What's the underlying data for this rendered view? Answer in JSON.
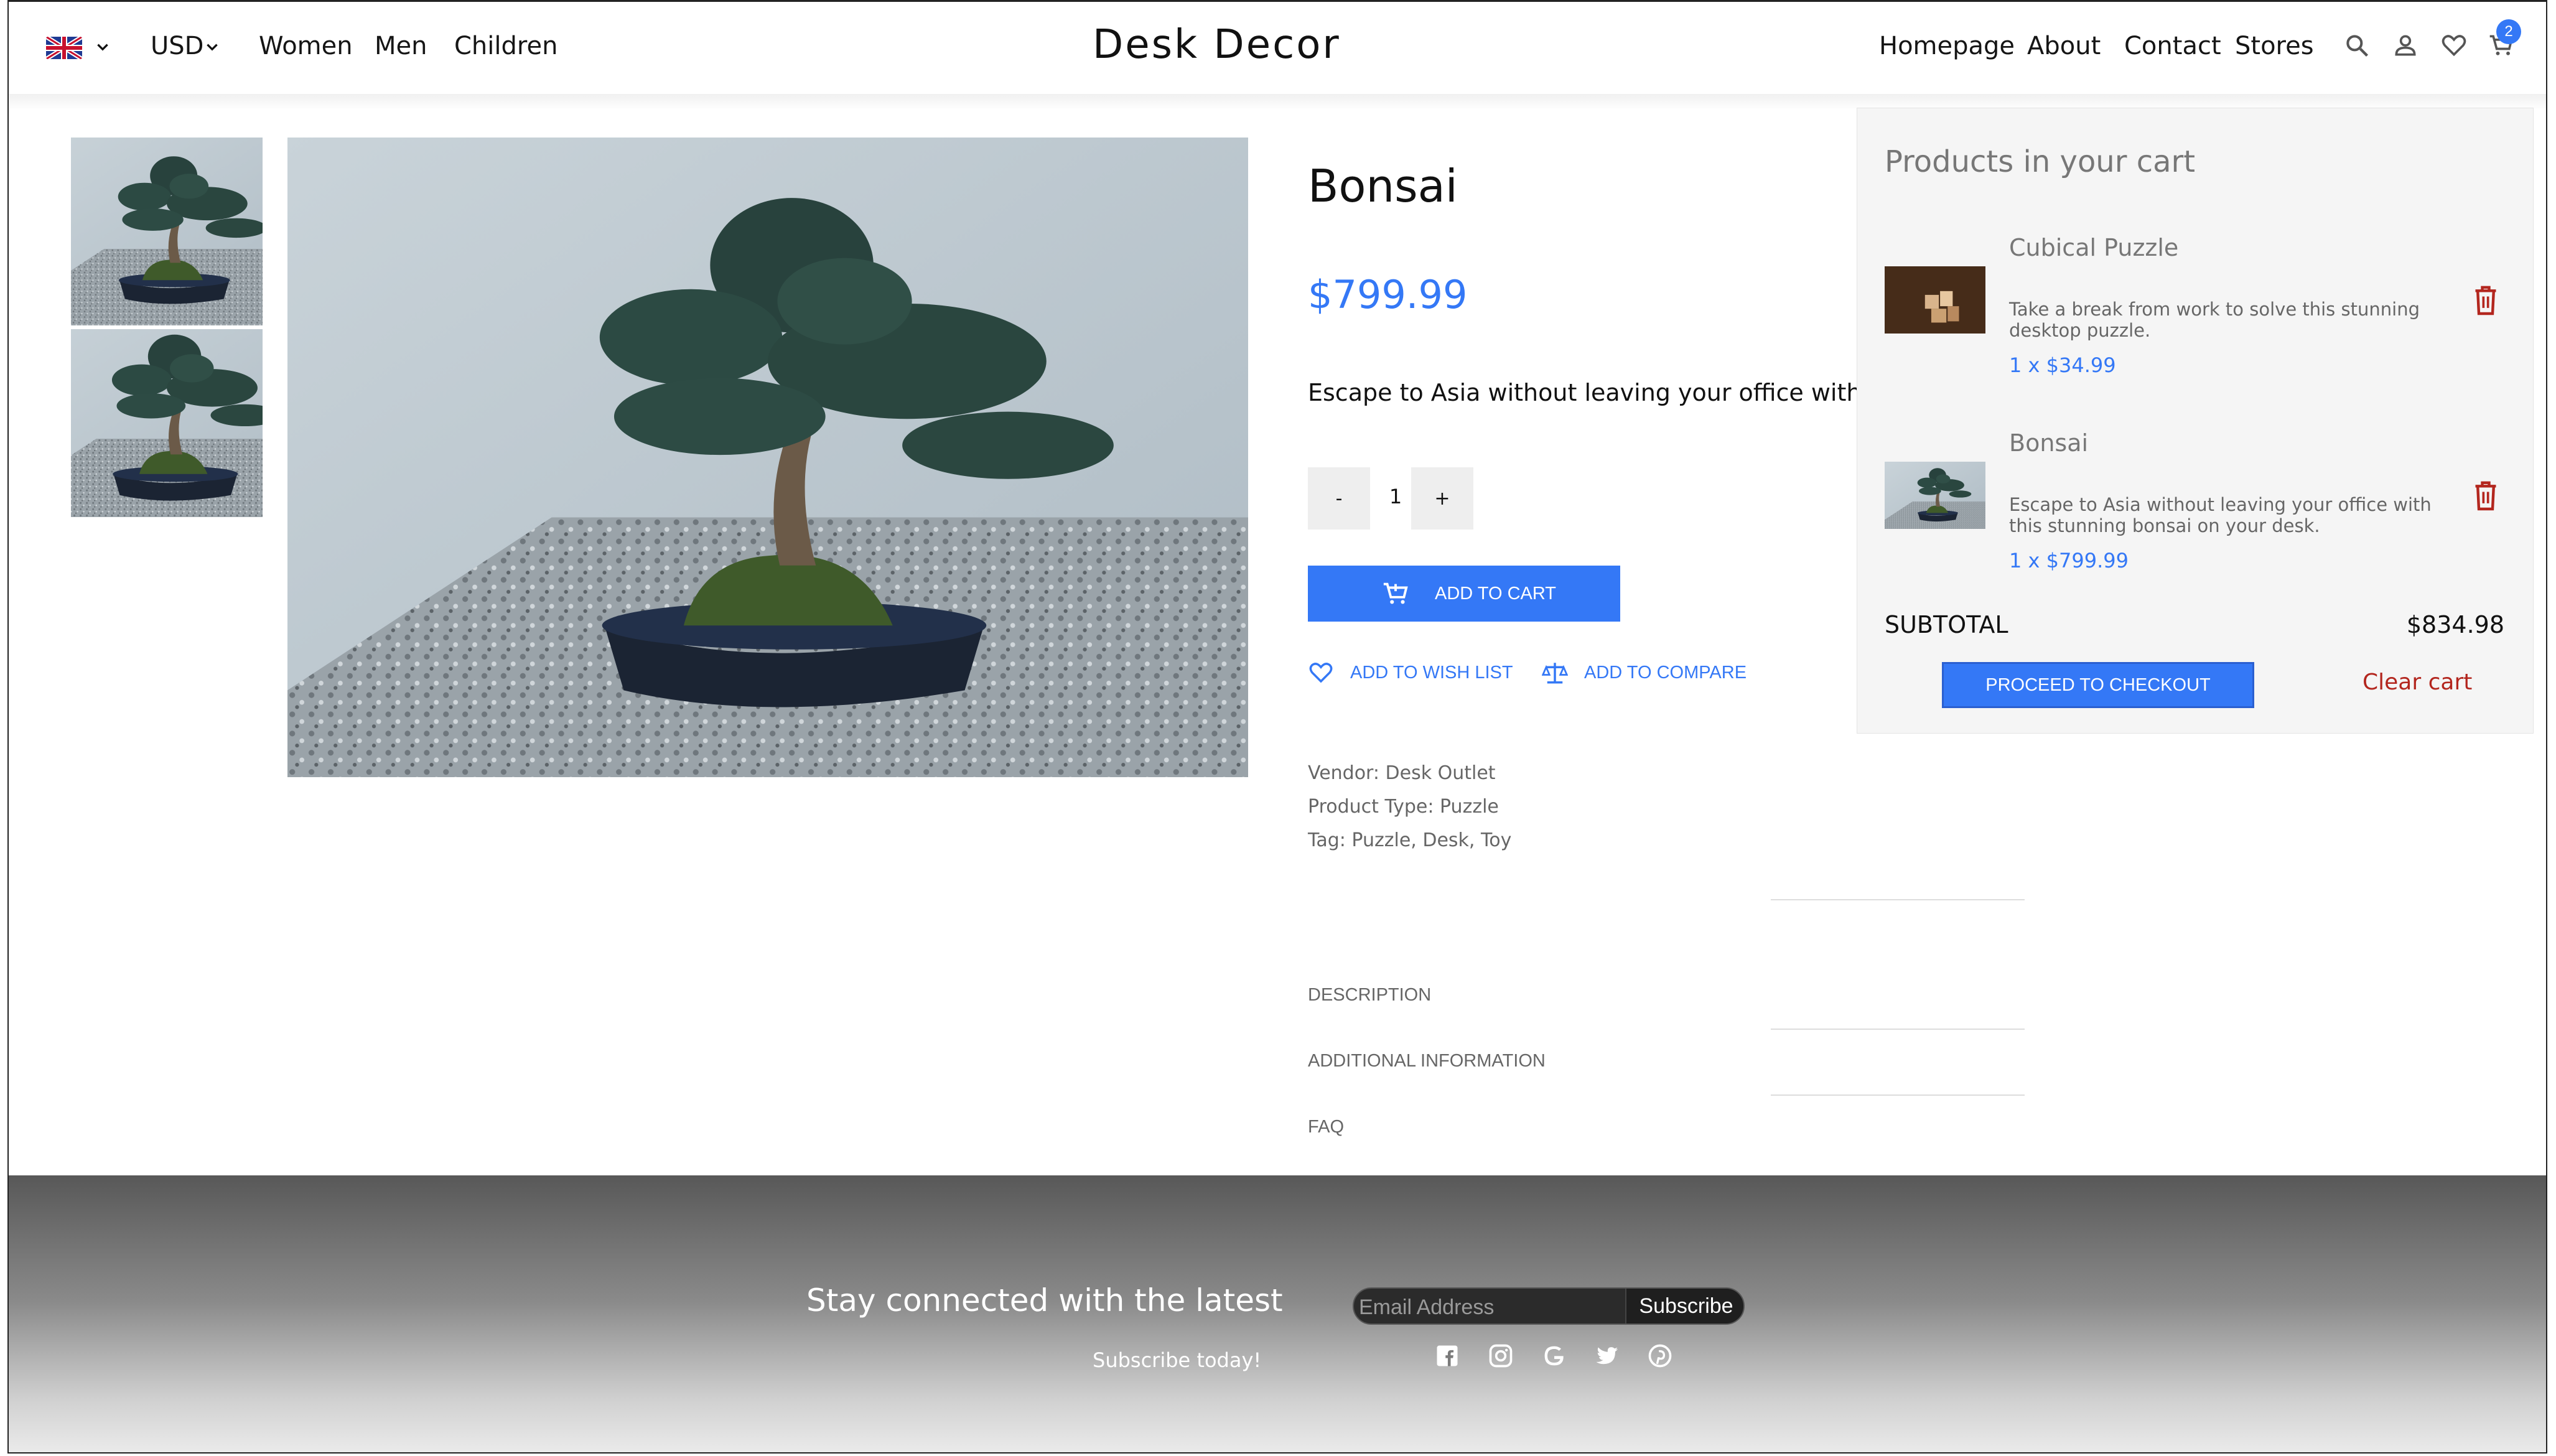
{
  "header": {
    "currency": "USD",
    "nav_left": [
      "Women",
      "Men",
      "Children"
    ],
    "logo": "Desk Decor",
    "nav_right": [
      "Homepage",
      "About",
      "Contact",
      "Stores"
    ],
    "cart_count": "2"
  },
  "product": {
    "title": "Bonsai",
    "price": "$799.99",
    "description": "Escape to Asia without leaving your office with this",
    "qty_minus": "-",
    "qty_value": "1",
    "qty_plus": "+",
    "add_to_cart": "ADD TO CART",
    "add_to_wishlist": "ADD TO WISH LIST",
    "add_to_compare": "ADD TO COMPARE",
    "vendor": "Vendor: Desk Outlet",
    "product_type": "Product Type: Puzzle",
    "tags": "Tag: Puzzle, Desk, Toy",
    "tabs": [
      "DESCRIPTION",
      "ADDITIONAL INFORMATION",
      "FAQ"
    ]
  },
  "cart": {
    "title": "Products in your cart",
    "items": [
      {
        "name": "Cubical Puzzle",
        "desc": "Take a break from work to solve this stunning desktop puzzle.",
        "qty": "1 x $34.99"
      },
      {
        "name": "Bonsai",
        "desc": "Escape to Asia without leaving your office with this stunning bonsai on your desk.",
        "qty": "1 x $799.99"
      }
    ],
    "subtotal_label": "SUBTOTAL",
    "subtotal_value": "$834.98",
    "checkout": "PROCEED TO CHECKOUT",
    "clear": "Clear cart"
  },
  "footer": {
    "headline": "Stay connected with the latest",
    "sub": "Subscribe today!",
    "email_placeholder": "Email Address",
    "subscribe": "Subscribe",
    "social_icons": [
      "facebook-icon",
      "instagram-icon",
      "google-icon",
      "twitter-icon",
      "pinterest-icon"
    ]
  },
  "colors": {
    "accent": "#3478f6",
    "danger": "#b3261e"
  }
}
